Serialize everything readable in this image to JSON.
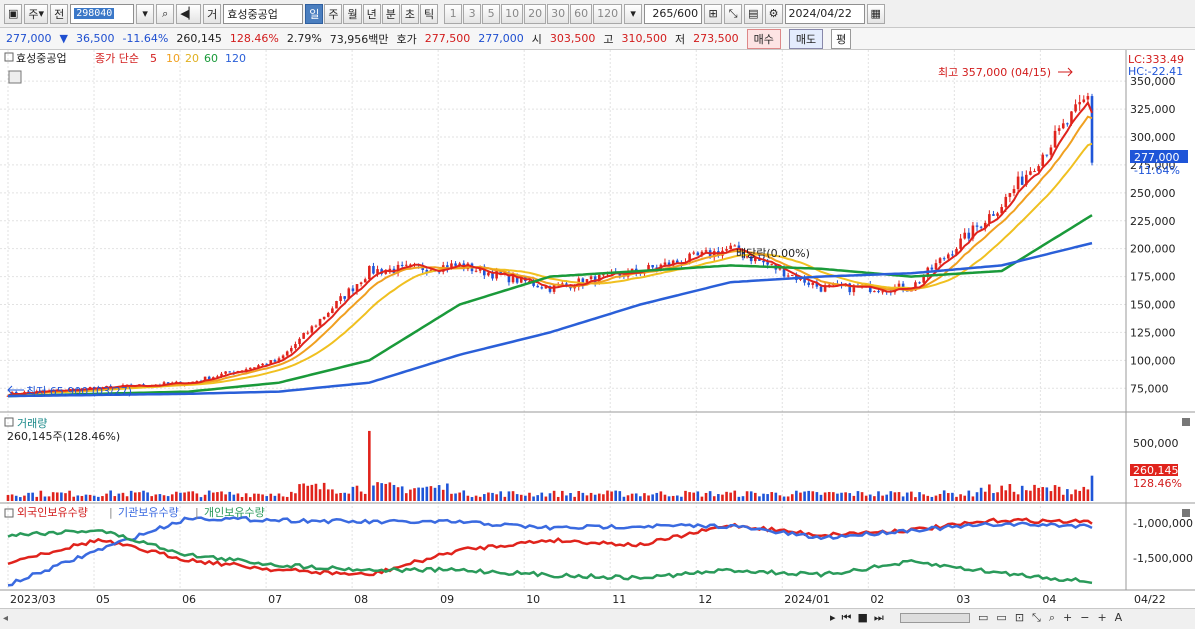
{
  "toolbar": {
    "type_label": "주",
    "prev_label": "전",
    "code": "298040",
    "g_label": "거",
    "stock_name": "효성중공업",
    "periods": [
      "일",
      "주",
      "월",
      "년",
      "분",
      "초",
      "틱"
    ],
    "active_period": "일",
    "intervals": [
      "1",
      "3",
      "5",
      "10",
      "20",
      "30",
      "60",
      "120"
    ],
    "count": "265",
    "count_max": "/600",
    "date": "2024/04/22"
  },
  "quote": {
    "price": "277,000",
    "change": "36,500",
    "change_pct": "-11.64%",
    "volume": "260,145",
    "volume_ratio": "128.46%",
    "turnover_pct": "2.79%",
    "amount": "73,956백만",
    "bid_label": "호가",
    "bid": "277,500",
    "ask": "277,000",
    "open_label": "시",
    "open": "303,500",
    "high_label": "고",
    "high": "310,500",
    "low_label": "저",
    "low": "273,500",
    "buy_label": "매수",
    "sell_label": "매도",
    "avg_label": "평"
  },
  "price_panel": {
    "name": "효성중공업",
    "ma_prefix": "종가 단순",
    "ma_periods": [
      "5",
      "10",
      "20",
      "60",
      "120"
    ],
    "lc": "LC:333.49",
    "hc": "HC:-22.41",
    "high_note": "최고 357,000 (04/15)",
    "low_note": "최저 65,900 (03/27)",
    "dividend_note": "배당락(0.00%)",
    "price_label": "277,000",
    "pct_label": "-11.64%",
    "y_ticks": [
      "75,000",
      "100,000",
      "125,000",
      "150,000",
      "175,000",
      "200,000",
      "225,000",
      "250,000",
      "275,000",
      "300,000",
      "325,000",
      "350,000"
    ]
  },
  "volume_panel": {
    "title": "거래량",
    "sub": "260,145주(128.46%)",
    "tick": "500,000",
    "last_value": "260,145",
    "last_pct": "128.46%"
  },
  "holdings_panel": {
    "series_names": [
      "외국인보유수량",
      "기관보유수량",
      "개인보유수량"
    ],
    "ticks": [
      "-1,000,000",
      "-1,500,000"
    ]
  },
  "x_axis": [
    "2023/03",
    "05",
    "06",
    "07",
    "08",
    "09",
    "10",
    "11",
    "12",
    "2024/01",
    "02",
    "03",
    "04",
    "04/22"
  ],
  "colors": {
    "up": "#e0231c",
    "down": "#1f55d8",
    "ma5": "#e0231c",
    "ma10": "#f0a020",
    "ma20": "#f0c020",
    "ma60": "#1a9a3a",
    "ma120": "#2a5fd8",
    "foreign": "#e0231c",
    "inst": "#3a6ae0",
    "indiv": "#2a9a5a"
  },
  "chart_data": {
    "type": "line",
    "x": [
      "2023/03",
      "05",
      "06",
      "07",
      "08",
      "09",
      "10",
      "11",
      "12",
      "2024/01",
      "02",
      "03",
      "04"
    ],
    "series": [
      {
        "name": "종가",
        "values": [
          70000,
          75000,
          80000,
          100000,
          180000,
          185000,
          165000,
          180000,
          200000,
          165000,
          165000,
          240000,
          340000
        ]
      },
      {
        "name": "60",
        "values": [
          68000,
          70000,
          72000,
          80000,
          100000,
          150000,
          175000,
          180000,
          185000,
          182000,
          175000,
          180000,
          230000
        ]
      },
      {
        "name": "120",
        "values": [
          68000,
          69000,
          70000,
          72000,
          80000,
          105000,
          125000,
          150000,
          170000,
          175000,
          178000,
          185000,
          205000
        ]
      }
    ],
    "ylim": [
      60000,
      360000
    ]
  }
}
